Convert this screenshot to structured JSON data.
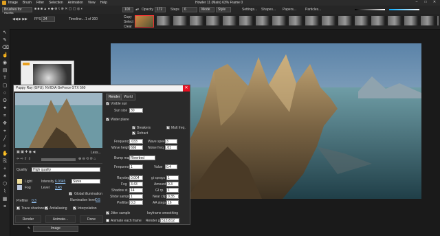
{
  "window": {
    "title": "Howler 11 (Main)  63%  Frame 0",
    "menu": [
      "Image",
      "Brush",
      "Filter",
      "Selection",
      "Animation",
      "View",
      "Help"
    ]
  },
  "toolbar": {
    "brush_preset": "Brushes for media",
    "size_value": "100",
    "opacity_label": "Opacity",
    "opacity_value": "172",
    "steps_label": "Steps",
    "steps_value": "6",
    "mode_value": "Mode",
    "style_value": "Style",
    "settings_label": "Settings...",
    "shapes_label": "Shapes...",
    "papers_label": "Papers...",
    "particles_label": "Particles..."
  },
  "toolbar2": {
    "fps_label": "FPS",
    "fps_value": "24",
    "timeline_label": "Timeline...",
    "frame_counter": "1 of 300",
    "layer_labels": [
      "Copy",
      "Select",
      "Clear"
    ]
  },
  "dialog": {
    "title": "Puppy Ray (GPU): NVIDIA GeForce GTX 560",
    "tabs": [
      "Render",
      "World"
    ],
    "less_label": "Less...",
    "quality_label": "Quality",
    "quality_value": "High quality",
    "light_label": "Light",
    "intensity_label": "Intensity",
    "intensity_value": "6.0345",
    "sizes_value": "Sizes",
    "fog_label": "Fog",
    "level_label": "Level",
    "level_value": "3.43",
    "global_illum_label": "Global illumination",
    "illum_level_label": "Illumination level",
    "illum_level_value": "0.5",
    "prefilter_label": "Prefilter",
    "prefilter_value": "0.3",
    "trace_shadows": "Trace shadows",
    "antialiasing": "Antialiasing",
    "interpolation": "Interpolation",
    "render_btn": "Render",
    "animate_btn": "Animate...",
    "done_btn": "Done"
  },
  "world": {
    "visible_sun": "Visible sun",
    "sun_size_label": "Sun size",
    "sun_size_value": "30",
    "water_plane": "Water plane",
    "breakers": "Breakers",
    "multi_freq": "Mult freq.",
    "refract": "Refract",
    "frequency_label": "Frequency",
    "frequency_value": ".033",
    "wave_speed_label": "Wave speed",
    "wave_speed_value": "3",
    "wave_height_label": "Wave height",
    "wave_height_value": "666",
    "noise_freq_label": "Noise freq.",
    "noise_freq_value": ".01",
    "bump_map_label": "Bump map",
    "bump_map_value": "Riverbed",
    "frequency2_label": "Frequency",
    "frequency2_value": "1",
    "value_label": "Value",
    "value_value": "0.4",
    "raystep_label": "Raystep",
    "raystep_value": "0.004",
    "gi_sprays_label": "gi sprays",
    "gi_sprays_value": "1",
    "fog_label": "Fog",
    "fog_value": "3.43",
    "amount_label": "Amount",
    "amount_value": "0.3",
    "shadow_st_label": "Shadow st.",
    "shadow_st_value": "14",
    "gi_rp_label": "GI rp.",
    "gi_rp_value": "1",
    "shdw_samps_label": "Shdw samps",
    "shdw_samps_value": "1",
    "near_clip_label": "Near clip",
    "near_clip_value": "0.35",
    "prefilter_label": "Prefilter",
    "prefilter_value": "0.3",
    "aa_steps_label": "AA steps",
    "aa_steps_value": "16",
    "jitter_sample": "Jitter sample",
    "keyframe_label": "keyframe smoothing",
    "animate_each_frame": "Animate each frame",
    "render_grid_label": "Render grid",
    "render_grid_value": "512x512"
  },
  "bottom": {
    "image_dropdown": "Image"
  },
  "colors": {
    "accent": "#0078d7",
    "close": "#e81123",
    "panel": "#2a2a2a"
  }
}
